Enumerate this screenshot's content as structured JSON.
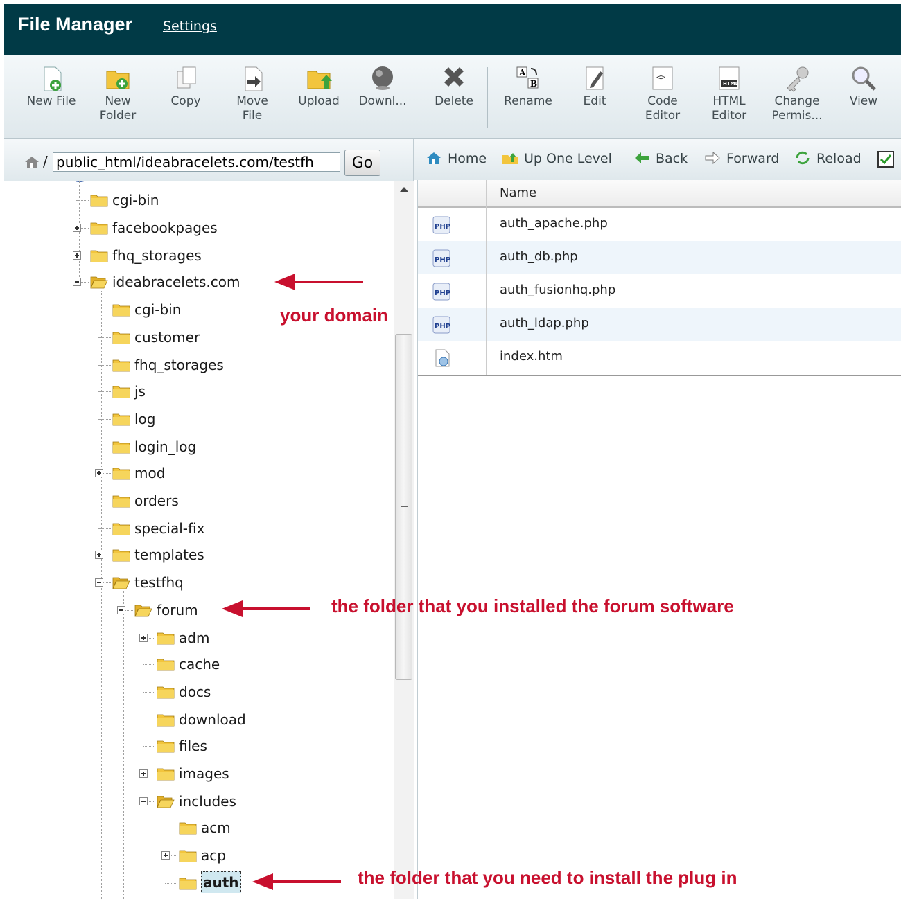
{
  "header": {
    "title": "File Manager",
    "settings_link": "Settings"
  },
  "toolbar": {
    "buttons": [
      {
        "label_1": "New File",
        "label_2": "",
        "icon": "new-file-icon"
      },
      {
        "label_1": "New",
        "label_2": "Folder",
        "icon": "new-folder-icon"
      },
      {
        "label_1": "Copy",
        "label_2": "",
        "icon": "copy-icon"
      },
      {
        "label_1": "Move",
        "label_2": "File",
        "icon": "move-file-icon"
      },
      {
        "label_1": "Upload",
        "label_2": "",
        "icon": "upload-icon"
      },
      {
        "label_1": "Downl...",
        "label_2": "",
        "icon": "download-icon"
      },
      {
        "label_1": "Delete",
        "label_2": "",
        "icon": "delete-icon"
      },
      {
        "label_1": "Rename",
        "label_2": "",
        "icon": "rename-icon"
      },
      {
        "label_1": "Edit",
        "label_2": "",
        "icon": "edit-icon"
      },
      {
        "label_1": "Code",
        "label_2": "Editor",
        "icon": "code-editor-icon"
      },
      {
        "label_1": "HTML",
        "label_2": "Editor",
        "icon": "html-editor-icon"
      },
      {
        "label_1": "Change",
        "label_2": "Permis...",
        "icon": "permissions-icon"
      },
      {
        "label_1": "View",
        "label_2": "",
        "icon": "view-icon"
      }
    ]
  },
  "path": {
    "slash": "/",
    "value": "public_html/ideabracelets.com/testfh",
    "go_label": "Go"
  },
  "nav": {
    "home": "Home",
    "up_one_level": "Up One Level",
    "back": "Back",
    "forward": "Forward",
    "reload": "Reload"
  },
  "tree": {
    "nodes": [
      {
        "label": "cgi-bin"
      },
      {
        "label": "facebookpages"
      },
      {
        "label": "fhq_storages"
      },
      {
        "label": "ideabracelets.com"
      },
      {
        "label": "cgi-bin"
      },
      {
        "label": "customer"
      },
      {
        "label": "fhq_storages"
      },
      {
        "label": "js"
      },
      {
        "label": "log"
      },
      {
        "label": "login_log"
      },
      {
        "label": "mod"
      },
      {
        "label": "orders"
      },
      {
        "label": "special-fix"
      },
      {
        "label": "templates"
      },
      {
        "label": "testfhq"
      },
      {
        "label": "forum"
      },
      {
        "label": "adm"
      },
      {
        "label": "cache"
      },
      {
        "label": "docs"
      },
      {
        "label": "download"
      },
      {
        "label": "files"
      },
      {
        "label": "images"
      },
      {
        "label": "includes"
      },
      {
        "label": "acm"
      },
      {
        "label": "acp"
      },
      {
        "label": "auth"
      }
    ]
  },
  "filelist": {
    "column_name": "Name",
    "files": [
      {
        "name": "auth_apache.php",
        "icon": "php-file-icon"
      },
      {
        "name": "auth_db.php",
        "icon": "php-file-icon"
      },
      {
        "name": "auth_fusionhq.php",
        "icon": "php-file-icon"
      },
      {
        "name": "auth_ldap.php",
        "icon": "php-file-icon"
      },
      {
        "name": "index.htm",
        "icon": "html-file-icon"
      }
    ]
  },
  "annotations": {
    "domain": "your domain",
    "forum": "the folder that you installed the forum software",
    "plugin": "the folder that you need to install the plug in"
  },
  "colors": {
    "header_bg": "#013a46",
    "annotation": "#c8102e",
    "folder": "#f2c53d"
  }
}
